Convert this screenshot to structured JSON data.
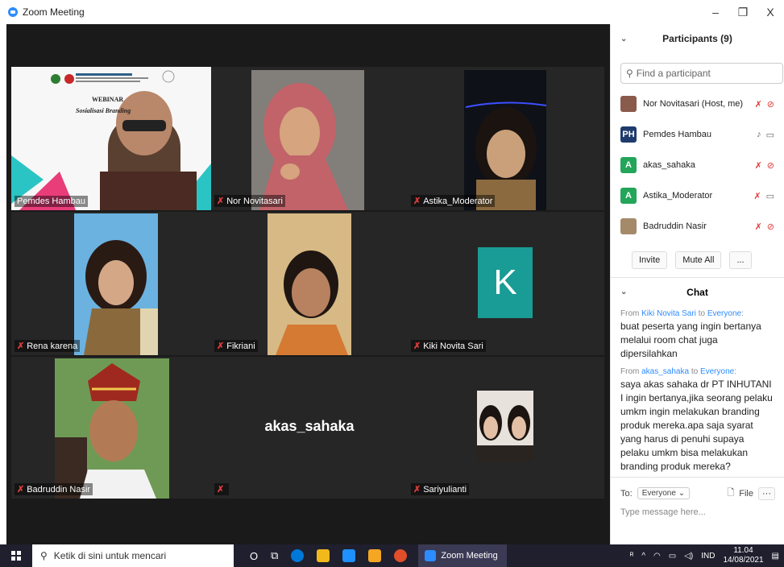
{
  "window": {
    "title": "Zoom Meeting",
    "minimize": "–",
    "restore": "❐",
    "close": "X"
  },
  "tiles": [
    {
      "name": "Pemdes Hambau",
      "muted": false,
      "slide_title": "WEBINAR",
      "slide_subtitle": "Sosialisasi Branding"
    },
    {
      "name": "Nor Novitasari",
      "muted": true
    },
    {
      "name": "Astika_Moderator",
      "muted": true
    },
    {
      "name": "Rena karena",
      "muted": true
    },
    {
      "name": "Fikriani",
      "muted": true
    },
    {
      "name": "Kiki Novita Sari",
      "muted": true,
      "avatar_letter": "K"
    },
    {
      "name": "Badruddin Nasir",
      "muted": true
    },
    {
      "name": "",
      "muted": true,
      "center_name": "akas_sahaka"
    },
    {
      "name": "Sariyulianti",
      "muted": true
    }
  ],
  "participants_panel": {
    "title": "Participants (9)",
    "search_placeholder": "Find a participant",
    "participants": [
      {
        "name": "Nor Novitasari  (Host, me)",
        "avatar": "",
        "color": "#8a5a4a",
        "mic": "muted",
        "video": "off"
      },
      {
        "name": "Pemdes Hambau",
        "avatar": "PH",
        "color": "#1f3b6e",
        "mic": "on",
        "video": "on"
      },
      {
        "name": "akas_sahaka",
        "avatar": "A",
        "color": "#23a55a",
        "mic": "muted",
        "video": "off"
      },
      {
        "name": "Astika_Moderator",
        "avatar": "A",
        "color": "#23a55a",
        "mic": "muted",
        "video": "on"
      },
      {
        "name": "Badruddin Nasir",
        "avatar": "",
        "color": "#a58a6a",
        "mic": "muted",
        "video": "off"
      }
    ],
    "invite_label": "Invite",
    "mute_all_label": "Mute All",
    "more_label": "..."
  },
  "chat": {
    "title": "Chat",
    "messages": [
      {
        "from_prefix": "From ",
        "from": "Kiki Novita Sari",
        "to_prefix": " to ",
        "to": "Everyone",
        "suffix": ":",
        "text": "buat peserta yang ingin bertanya melalui room chat juga dipersilahkan"
      },
      {
        "from_prefix": "From ",
        "from": "akas_sahaka",
        "to_prefix": " to ",
        "to": "Everyone",
        "suffix": ":",
        "text": "saya akas sahaka dr PT INHUTANI I ingin bertanya,jika seorang pelaku umkm ingin melakukan branding produk mereka.apa saja syarat yang harus di penuhi supaya pelaku umkm bisa melakukan branding produk mereka?"
      }
    ],
    "to_label": "To:",
    "to_value": "Everyone ⌄",
    "file_label": "File",
    "more_label": "···",
    "input_placeholder": "Type message here..."
  },
  "taskbar": {
    "search_placeholder": "Ketik di sini untuk mencari",
    "zoom_label": "Zoom Meeting",
    "lang": "IND",
    "time": "11.04",
    "date": "14/08/2021",
    "colors": [
      "#0078d7",
      "#f2b81c",
      "#1e90ff",
      "#f5a623",
      "#e04e2a"
    ]
  }
}
